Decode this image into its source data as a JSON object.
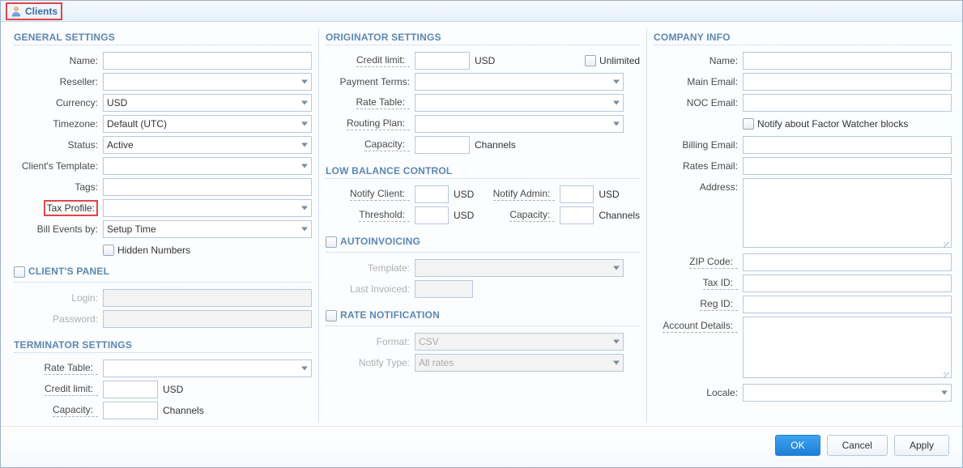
{
  "window": {
    "title": "Clients"
  },
  "general": {
    "heading": "GENERAL SETTINGS",
    "name_label": "Name:",
    "reseller_label": "Reseller:",
    "currency_label": "Currency:",
    "currency_value": "USD",
    "timezone_label": "Timezone:",
    "timezone_value": "Default (UTC)",
    "status_label": "Status:",
    "status_value": "Active",
    "template_label": "Client's Template:",
    "tags_label": "Tags:",
    "tax_profile_label": "Tax Profile:",
    "bill_events_label": "Bill Events by:",
    "bill_events_value": "Setup Time",
    "hidden_numbers_label": "Hidden Numbers"
  },
  "clients_panel": {
    "heading": "CLIENT'S PANEL",
    "login_label": "Login:",
    "password_label": "Password:"
  },
  "terminator": {
    "heading": "TERMINATOR SETTINGS",
    "rate_table_label": "Rate Table:",
    "credit_limit_label": "Credit limit:",
    "credit_limit_suffix": "USD",
    "capacity_label": "Capacity:",
    "capacity_suffix": "Channels"
  },
  "originator": {
    "heading": "ORIGINATOR SETTINGS",
    "credit_limit_label": "Credit limit:",
    "credit_limit_suffix": "USD",
    "unlimited_label": "Unlimited",
    "payment_terms_label": "Payment Terms:",
    "rate_table_label": "Rate Table:",
    "routing_plan_label": "Routing Plan:",
    "capacity_label": "Capacity:",
    "capacity_suffix": "Channels"
  },
  "low_balance": {
    "heading": "LOW BALANCE CONTROL",
    "notify_client_label": "Notify Client:",
    "notify_client_suffix": "USD",
    "notify_admin_label": "Notify Admin:",
    "notify_admin_suffix": "USD",
    "threshold_label": "Threshold:",
    "threshold_suffix": "USD",
    "capacity_label": "Capacity:",
    "capacity_suffix": "Channels"
  },
  "autoinvoicing": {
    "heading": "AUTOINVOICING",
    "template_label": "Template:",
    "last_invoiced_label": "Last Invoiced:"
  },
  "rate_notif": {
    "heading": "RATE NOTIFICATION",
    "format_label": "Format:",
    "format_value": "CSV",
    "notify_type_label": "Notify Type:",
    "notify_type_value": "All rates"
  },
  "company": {
    "heading": "COMPANY INFO",
    "name_label": "Name:",
    "main_email_label": "Main Email:",
    "noc_email_label": "NOC Email:",
    "notify_factor_label": "Notify about Factor Watcher blocks",
    "billing_email_label": "Billing Email:",
    "rates_email_label": "Rates Email:",
    "address_label": "Address:",
    "zip_label": "ZIP Code:",
    "tax_id_label": "Tax ID:",
    "reg_id_label": "Reg ID:",
    "account_details_label": "Account Details:",
    "locale_label": "Locale:"
  },
  "footer": {
    "ok": "OK",
    "cancel": "Cancel",
    "apply": "Apply"
  }
}
